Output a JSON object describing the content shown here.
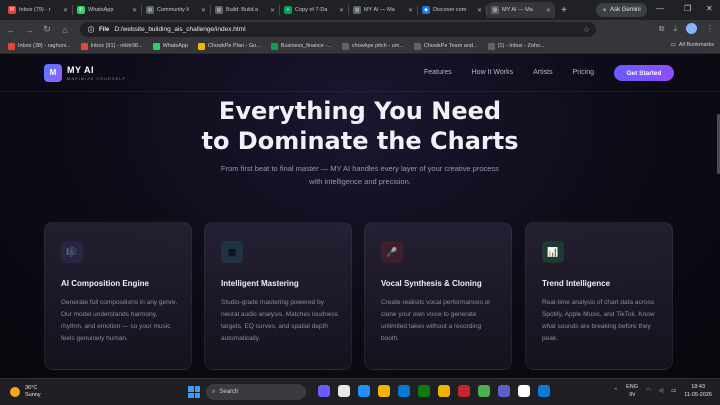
{
  "browser": {
    "tabs": [
      {
        "label": "Inbox (79) - r",
        "color": "#ea4335",
        "glyph": "M"
      },
      {
        "label": "WhatsApp",
        "color": "#25d366",
        "glyph": "✆"
      },
      {
        "label": "Community li",
        "color": "#5f6368",
        "glyph": "◎"
      },
      {
        "label": "Build: Build a",
        "color": "#5f6368",
        "glyph": "◎"
      },
      {
        "label": "Copy of 7-Da",
        "color": "#0f9d58",
        "glyph": "+"
      },
      {
        "label": "MY AI — Ma",
        "color": "#5f6368",
        "glyph": "◎"
      },
      {
        "label": "Discover com",
        "color": "#1a73e8",
        "glyph": "◆"
      },
      {
        "label": "MY AI — Ma",
        "color": "#5f6368",
        "glyph": "◎",
        "active": true
      }
    ],
    "ask_gemini": "Ask Gemini",
    "omnibox_chip": "File",
    "url": "D:/website_building_ais_challenge/index.html",
    "bookmarks": [
      {
        "label": "Inbox (38) - raghuni...",
        "color": "#ea4335"
      },
      {
        "label": "Inbox (91) - nikitr98...",
        "color": "#ea4335"
      },
      {
        "label": "WhatsApp",
        "color": "#25d366"
      },
      {
        "label": "ChowkPe Plan - Go...",
        "color": "#f4b400"
      },
      {
        "label": "Business_finance -...",
        "color": "#0f9d58"
      },
      {
        "label": "chowkpe pitch - um...",
        "color": "#5f6368"
      },
      {
        "label": "ChowkPe Team and...",
        "color": "#5f6368"
      },
      {
        "label": "(1) - Inbox - Zoho...",
        "color": "#5f6368"
      }
    ],
    "all_bookmarks": "All Bookmarks"
  },
  "site": {
    "logo_mark": "M",
    "logo_name": "MY AI",
    "logo_tagline": "MAXIMIZE YOURSELF",
    "nav": [
      "Features",
      "How It Works",
      "Artists",
      "Pricing"
    ],
    "cta": "Get Started",
    "hero_line1": "Everything You Need",
    "hero_line2": "to Dominate the Charts",
    "hero_sub": "From first beat to final master — MY AI handles every layer of your creative process with intelligence and precision.",
    "cards": [
      {
        "title": "AI Composition Engine",
        "body": "Generate full compositions in any genre. Our model understands harmony, rhythm, and emotion — so your music feels genuinely human.",
        "icon": "🎼",
        "icon_bg": "#2a2545"
      },
      {
        "title": "Intelligent Mastering",
        "body": "Studio-grade mastering powered by neural audio analysis. Matches loudness targets, EQ curves, and spatial depth automatically.",
        "icon": "▦",
        "icon_bg": "#1f3345"
      },
      {
        "title": "Vocal Synthesis & Cloning",
        "body": "Create realistic vocal performances or clone your own voice to generate unlimited takes without a recording booth.",
        "icon": "🎤",
        "icon_bg": "#3d1f2c"
      },
      {
        "title": "Trend Intelligence",
        "body": "Real-time analysis of chart data across Spotify, Apple Music, and TikTok. Know what sounds are breaking before they peak.",
        "icon": "📊",
        "icon_bg": "#1f3a30"
      }
    ]
  },
  "taskbar": {
    "temp": "36°C",
    "condition": "Sunny",
    "search": "Search",
    "lang1": "ENG",
    "lang2": "IN",
    "time": "18:43",
    "date": "11-05-2026"
  }
}
